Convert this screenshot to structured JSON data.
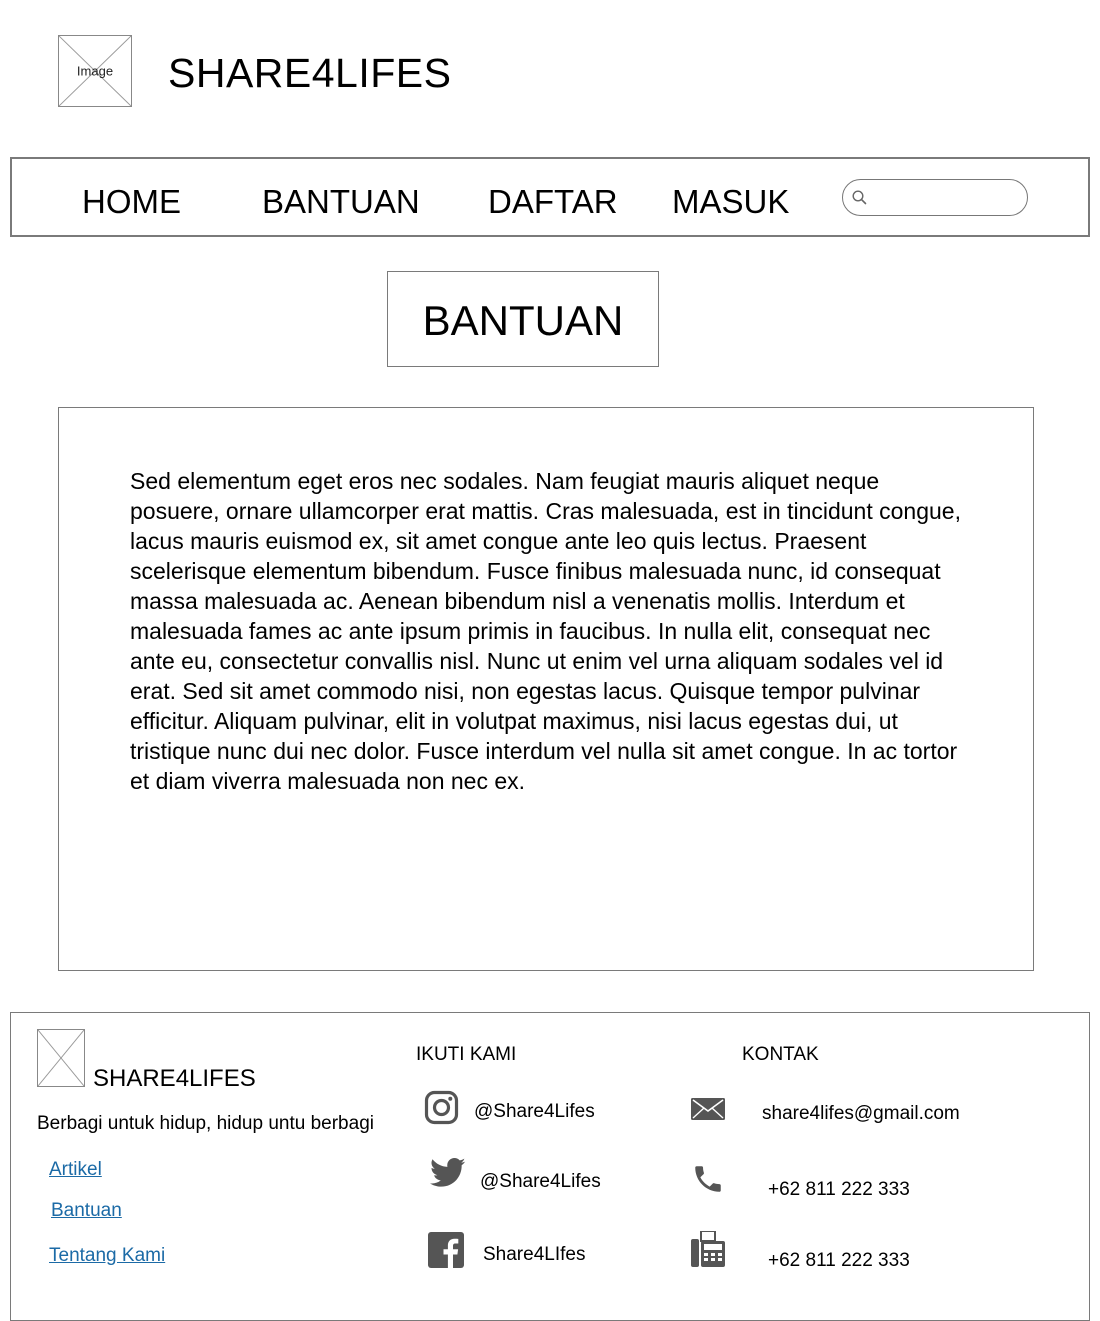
{
  "header": {
    "logo_label": "Image",
    "title": "SHARE4LIFES"
  },
  "nav": {
    "items": [
      "HOME",
      "BANTUAN",
      "DAFTAR",
      "MASUK"
    ],
    "search_placeholder": ""
  },
  "main": {
    "heading": "BANTUAN",
    "body": "Sed elementum eget eros nec sodales. Nam feugiat mauris aliquet neque posuere, ornare ullamcorper erat mattis. Cras malesuada, est in tincidunt congue, lacus mauris euismod ex, sit amet congue ante leo quis lectus. Praesent scelerisque elementum bibendum. Fusce finibus malesuada nunc, id consequat massa malesuada ac. Aenean bibendum nisl a venenatis mollis. Interdum et malesuada fames ac ante ipsum primis in faucibus. In nulla elit, consequat nec ante eu, consectetur convallis nisl. Nunc ut enim vel urna aliquam sodales vel id erat. Sed sit amet commodo nisi, non egestas lacus. Quisque tempor pulvinar efficitur. Aliquam pulvinar, elit in volutpat maximus, nisi lacus egestas dui, ut tristique nunc dui nec dolor. Fusce interdum vel nulla sit amet congue. In ac tortor et diam viverra malesuada non nec ex."
  },
  "footer": {
    "brand": "SHARE4LIFES",
    "tagline": "Berbagi untuk hidup, hidup untu berbagi",
    "links": [
      "Artikel",
      "Bantuan",
      "Tentang Kami"
    ],
    "follow": {
      "heading": "IKUTI KAMI",
      "instagram": "@Share4Lifes",
      "twitter": "@Share4Lifes",
      "facebook": "Share4LIfes"
    },
    "contact": {
      "heading": "KONTAK",
      "email": "share4lifes@gmail.com",
      "phone": "+62 811 222 333",
      "fax": "+62 811 222 333"
    },
    "icons": [
      "instagram-icon",
      "twitter-icon",
      "facebook-icon",
      "mail-icon",
      "phone-icon",
      "fax-icon"
    ],
    "icon_color": "#555555",
    "link_color": "#1b6aa6"
  }
}
